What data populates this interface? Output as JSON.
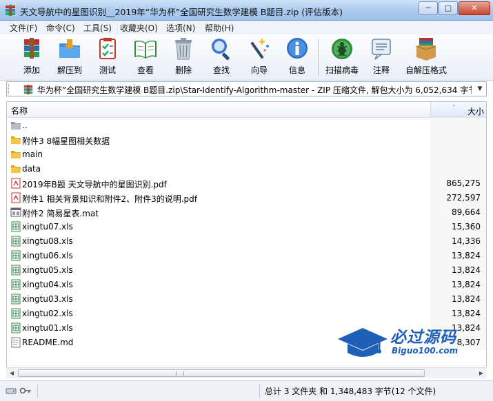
{
  "window": {
    "title": "天文导航中的星图识别__2019年“华为杯”全国研究生数学建模 B题目.zip (评估版本)",
    "min_label": "─",
    "max_label": "□",
    "close_label": "✕"
  },
  "menu": [
    "文件(F)",
    "命令(C)",
    "工具(S)",
    "收藏夹(O)",
    "选项(N)",
    "帮助(H)"
  ],
  "toolbar": [
    {
      "label": "添加",
      "icon": "add-archive-icon"
    },
    {
      "label": "解压到",
      "icon": "extract-folder-icon"
    },
    {
      "label": "测试",
      "icon": "test-checklist-icon"
    },
    {
      "label": "查看",
      "icon": "view-book-icon"
    },
    {
      "label": "删除",
      "icon": "trash-icon"
    },
    {
      "label": "查找",
      "icon": "find-magnifier-icon"
    },
    {
      "label": "向导",
      "icon": "wizard-wand-icon"
    },
    {
      "label": "信息",
      "icon": "info-icon"
    },
    {
      "label": "扫描病毒",
      "icon": "virus-scan-icon"
    },
    {
      "label": "注释",
      "icon": "comment-icon"
    },
    {
      "label": "自解压格式",
      "icon": "sfx-box-icon"
    }
  ],
  "address": {
    "path": "华为杯”全国研究生数学建模 B题目.zip\\Star-Identify-Algorithm-master - ZIP 压缩文件, 解包大小为 6,052,634 字节",
    "dropdown": "▼"
  },
  "columns": {
    "name": "名称",
    "size": "大小"
  },
  "files": [
    {
      "name": "..",
      "size": "",
      "type": "parent"
    },
    {
      "name": "附件3 8幅星图相关数据",
      "size": "",
      "type": "folder"
    },
    {
      "name": "main",
      "size": "",
      "type": "folder"
    },
    {
      "name": "data",
      "size": "",
      "type": "folder"
    },
    {
      "name": "2019年B题  天文导航中的星图识别.pdf",
      "size": "865,275",
      "type": "pdf"
    },
    {
      "name": "附件1  相关背景知识和附件2、附件3的说明.pdf",
      "size": "272,597",
      "type": "pdf"
    },
    {
      "name": "附件2  简易星表.mat",
      "size": "89,664",
      "type": "mat"
    },
    {
      "name": "xingtu07.xls",
      "size": "15,360",
      "type": "xls"
    },
    {
      "name": "xingtu08.xls",
      "size": "14,336",
      "type": "xls"
    },
    {
      "name": "xingtu06.xls",
      "size": "13,824",
      "type": "xls"
    },
    {
      "name": "xingtu05.xls",
      "size": "13,824",
      "type": "xls"
    },
    {
      "name": "xingtu04.xls",
      "size": "13,824",
      "type": "xls"
    },
    {
      "name": "xingtu03.xls",
      "size": "13,824",
      "type": "xls"
    },
    {
      "name": "xingtu02.xls",
      "size": "13,824",
      "type": "xls"
    },
    {
      "name": "xingtu01.xls",
      "size": "13,824",
      "type": "xls"
    },
    {
      "name": "README.md",
      "size": "8,307",
      "type": "text"
    }
  ],
  "watermark": {
    "brand": "必过源码",
    "site": "Biguo100.com"
  },
  "status": {
    "summary": "总计 3 文件夹 和 1,348,483 字节(12 个文件)"
  },
  "colors": {
    "accent": "#1e5fb8",
    "title_bg": "#a9c9ee"
  }
}
